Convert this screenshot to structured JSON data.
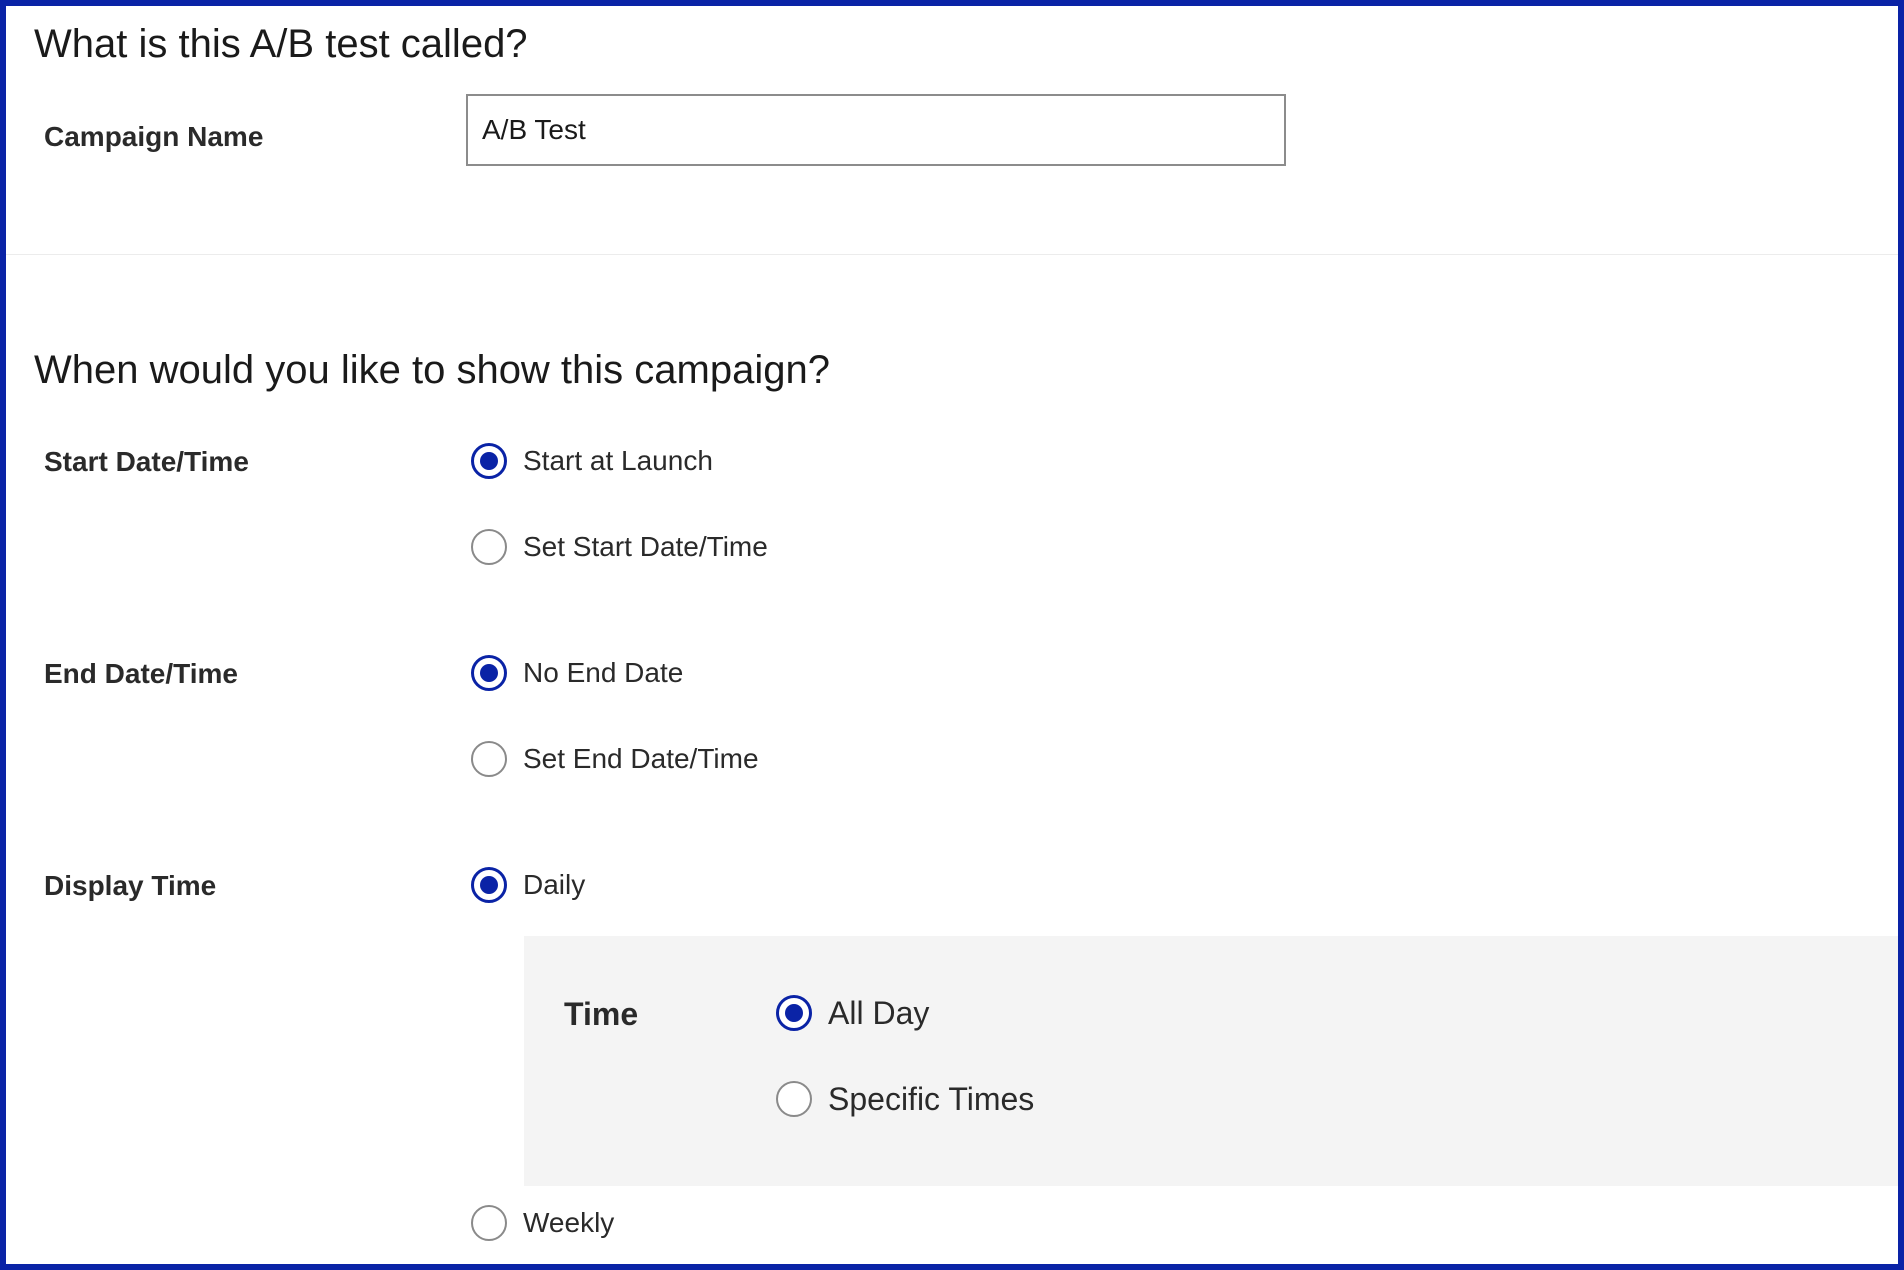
{
  "name_section": {
    "heading": "What is this A/B test called?",
    "campaign_name_label": "Campaign Name",
    "campaign_name_value": "A/B Test"
  },
  "schedule_section": {
    "heading": "When would you like to show this campaign?",
    "start": {
      "label": "Start Date/Time",
      "options": [
        {
          "label": "Start at Launch",
          "selected": true
        },
        {
          "label": "Set Start Date/Time",
          "selected": false
        }
      ]
    },
    "end": {
      "label": "End Date/Time",
      "options": [
        {
          "label": "No End Date",
          "selected": true
        },
        {
          "label": "Set End Date/Time",
          "selected": false
        }
      ]
    },
    "display_time": {
      "label": "Display Time",
      "options": [
        {
          "label": "Daily",
          "selected": true
        },
        {
          "label": "Weekly",
          "selected": false
        }
      ],
      "daily_panel": {
        "label": "Time",
        "options": [
          {
            "label": "All Day",
            "selected": true
          },
          {
            "label": "Specific Times",
            "selected": false
          }
        ]
      }
    }
  },
  "colors": {
    "accent": "#0a23a6",
    "panel_background": "#f4f4f4",
    "input_border": "#8c8c8c"
  }
}
